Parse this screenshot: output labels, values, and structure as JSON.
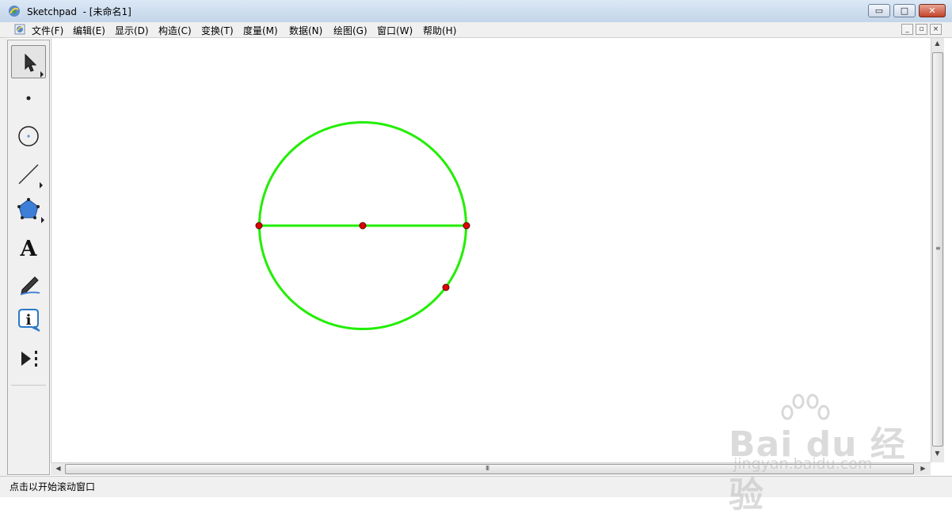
{
  "window": {
    "title": "Sketchpad  - [未命名1]",
    "buttons": {
      "minimize": "▭",
      "maximize": "□",
      "close": "✕"
    }
  },
  "menu": {
    "items": [
      "文件(F)",
      "编辑(E)",
      "显示(D)",
      "构造(C)",
      "变换(T)",
      "度量(M)",
      "数据(N)",
      "绘图(G)",
      "窗口(W)",
      "帮助(H)"
    ],
    "mdi_buttons": [
      "_",
      "▫",
      "×"
    ]
  },
  "toolbox": {
    "tools": [
      {
        "name": "arrow-tool-icon",
        "selected": true
      },
      {
        "name": "point-tool-icon",
        "selected": false
      },
      {
        "name": "compass-tool-icon",
        "selected": false
      },
      {
        "name": "line-tool-icon",
        "selected": false
      },
      {
        "name": "polygon-tool-icon",
        "selected": false
      },
      {
        "name": "text-tool-icon",
        "label": "A",
        "selected": false
      },
      {
        "name": "marker-tool-icon",
        "selected": false
      },
      {
        "name": "information-tool-icon",
        "selected": false
      },
      {
        "name": "custom-tool-icon",
        "selected": false
      }
    ]
  },
  "sketch": {
    "circle_color": "#22ee00",
    "point_color": "#e00000",
    "objects": [
      "circle",
      "diameter-segment",
      "left-endpoint",
      "center-point",
      "right-endpoint",
      "point-on-circle"
    ]
  },
  "scroll": {
    "h_grip": "III",
    "v_grip": "≡"
  },
  "status": {
    "text": "点击以开始滚动窗口"
  },
  "watermark": {
    "brand": "Bai du 经验",
    "url": "jingyan.baidu.com"
  }
}
